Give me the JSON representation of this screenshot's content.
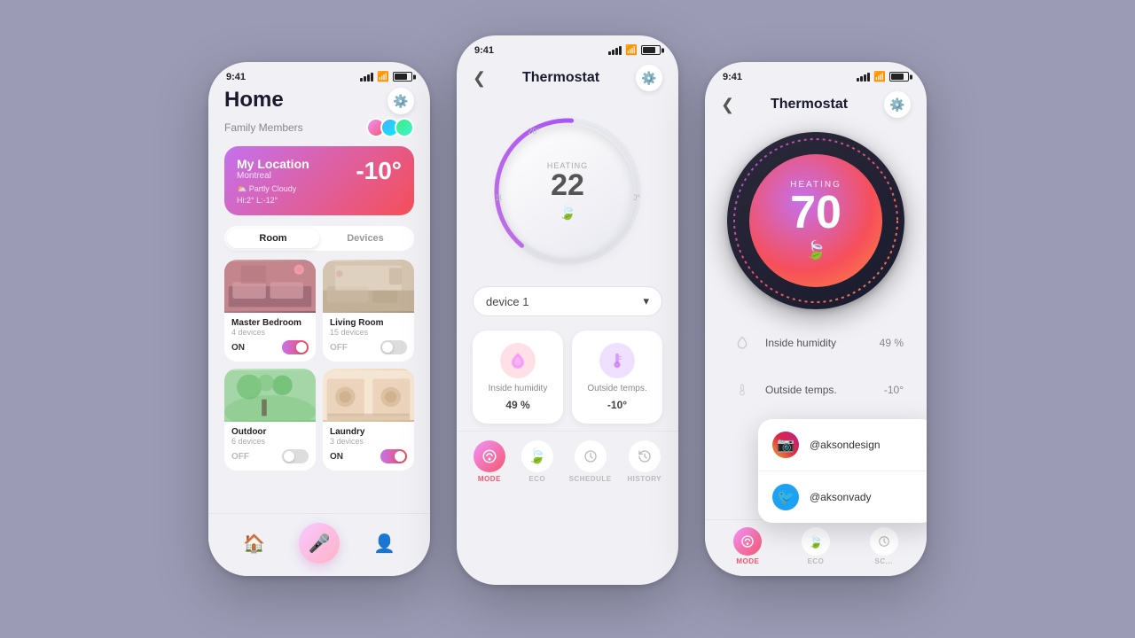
{
  "bg": "#9b9bb5",
  "left_phone": {
    "status_time": "9:41",
    "title": "Home",
    "family_label": "Family Members",
    "location_card": {
      "name": "My Location",
      "city": "Montreal",
      "temp": "-10°",
      "weather": "Partly Cloudy",
      "hilow": "Hi:2°  L:-12°"
    },
    "tabs": [
      "Room",
      "Devices"
    ],
    "active_tab": "Room",
    "rooms": [
      {
        "name": "Master Bedroom",
        "devices": "4 devices",
        "status": "ON",
        "on": true
      },
      {
        "name": "Living Room",
        "devices": "15 devices",
        "status": "OFF",
        "on": false
      },
      {
        "name": "",
        "devices": "",
        "status": "",
        "on": false
      },
      {
        "name": "",
        "devices": "",
        "status": "",
        "on": false
      }
    ]
  },
  "center_phone": {
    "status_time": "9:41",
    "title": "Thermostat",
    "dial_label": "HEATING",
    "dial_temp": "22",
    "device_selector": "device 1",
    "stats": [
      {
        "name": "Inside humidity",
        "value": "49 %",
        "icon": "💧"
      },
      {
        "name": "Outside temps.",
        "value": "-10°",
        "icon": "🌡"
      }
    ],
    "tabs": [
      {
        "label": "MODE",
        "active": true
      },
      {
        "label": "ECO",
        "active": false
      },
      {
        "label": "SCHEDULE",
        "active": false
      },
      {
        "label": "HISTORY",
        "active": false
      }
    ]
  },
  "right_phone": {
    "status_time": "9:41",
    "title": "Thermostat",
    "dial_label": "HEATING",
    "dial_temp": "70",
    "stats": [
      {
        "name": "Inside humidity",
        "value": "49 %",
        "icon": "💧"
      },
      {
        "name": "Outside temps.",
        "value": "-10°",
        "icon": "🌡"
      }
    ],
    "tabs": [
      {
        "label": "MODE",
        "active": true
      },
      {
        "label": "ECO",
        "active": false
      },
      {
        "label": "SC...",
        "active": false
      }
    ]
  },
  "social_popup": {
    "items": [
      {
        "platform": "instagram",
        "handle": "@aksondesign"
      },
      {
        "platform": "twitter",
        "handle": "@aksonvady"
      }
    ]
  }
}
